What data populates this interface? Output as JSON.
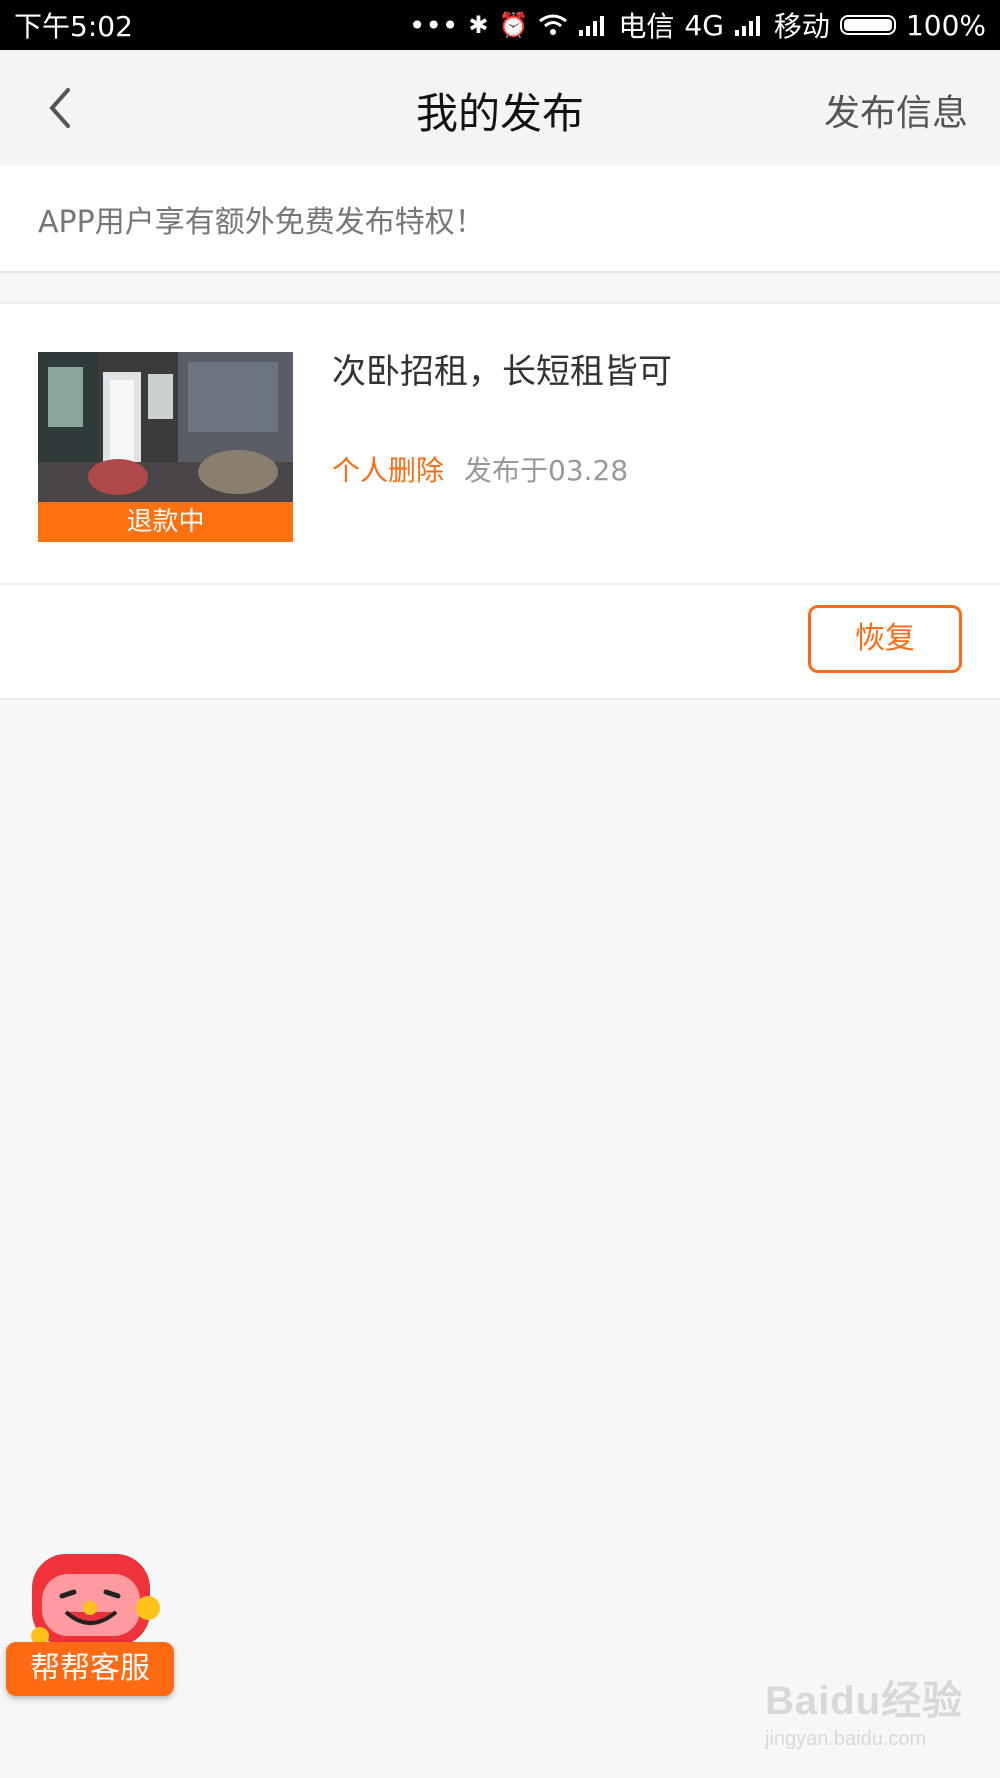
{
  "status_bar": {
    "time": "下午5:02",
    "dots": "•••",
    "carrier1": "电信",
    "network": "4G",
    "carrier2": "移动",
    "battery": "100%"
  },
  "nav": {
    "title": "我的发布",
    "right_action": "发布信息",
    "back_icon": "chevron-left-icon"
  },
  "notice": {
    "text": "APP用户享有额外免费发布特权！"
  },
  "listing": {
    "title": "次卧招租，长短租皆可",
    "badge": "退款中",
    "status": "个人删除",
    "date": "发布于03.28",
    "action_label": "恢复"
  },
  "service": {
    "label": "帮帮客服",
    "icon": "mascot-icon"
  },
  "watermark": {
    "main": "Baidu经验",
    "sub": "jingyan.baidu.com"
  },
  "colors": {
    "accent": "#ff6a13",
    "background": "#f6f7f9"
  }
}
